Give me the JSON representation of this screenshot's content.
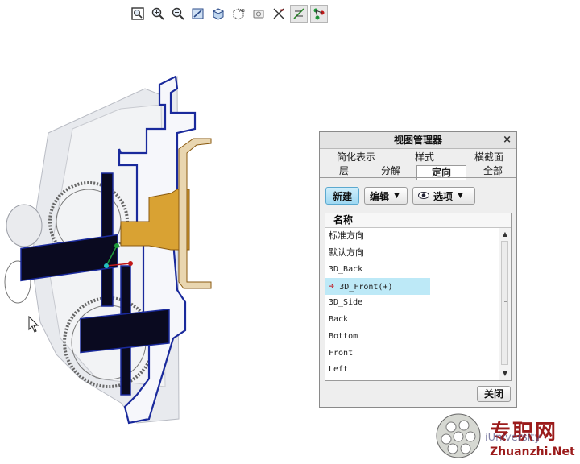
{
  "toolbar": {
    "buttons": [
      {
        "name": "refit-icon"
      },
      {
        "name": "zoom-in-icon"
      },
      {
        "name": "zoom-out-icon"
      },
      {
        "name": "repaint-icon"
      },
      {
        "name": "display-style-icon"
      },
      {
        "name": "saved-orientations-icon"
      },
      {
        "name": "view-manager-icon"
      },
      {
        "name": "perspective-icon"
      },
      {
        "name": "datum-display-icon"
      },
      {
        "name": "annotation-display-icon"
      }
    ]
  },
  "view_manager": {
    "title": "视图管理器",
    "close_symbol": "×",
    "tabs_row1": [
      "简化表示",
      "样式",
      "横截面"
    ],
    "tabs_row2": [
      "层",
      "分解",
      "定向",
      "全部"
    ],
    "active_tab": "定向",
    "buttons": {
      "new": "新建",
      "edit": "编辑",
      "options": "选项"
    },
    "list": {
      "header": "名称",
      "items": [
        "标准方向",
        "默认方向",
        "3D_Back",
        "3D_Front(+)",
        "3D_Side",
        "Back",
        "Bottom",
        "Front",
        "Left"
      ],
      "selected_index": 3
    },
    "close_button": "关闭"
  },
  "watermark": {
    "cn": "专职网",
    "en": "Zhuanzhi.Net",
    "overlay": "iUniversity"
  },
  "colors": {
    "accent_blue": "#9ed8f2",
    "selection": "#bde9f7",
    "section_edge": "#1a2a9c",
    "section_fill": "#0a0a20",
    "shaft_orange": "#d9a233",
    "watermark_red": "#9b1b1b"
  }
}
